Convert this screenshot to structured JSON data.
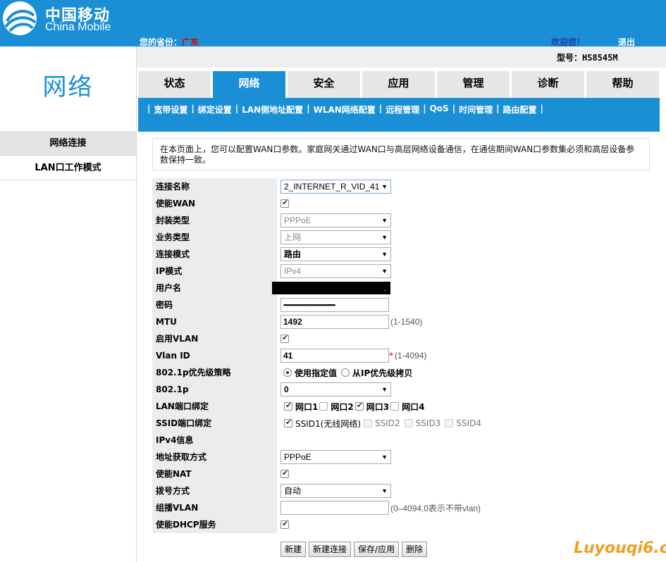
{
  "header": {
    "brand_cn": "中国移动",
    "brand_en": "China Mobile",
    "province_label": "您的省份：",
    "province_value": "广东",
    "welcome": "欢迎您！",
    "logout": "退出",
    "model": "型号：HS8545M"
  },
  "section_title": "网络",
  "left_nav": [
    {
      "label": "网络连接",
      "active": true
    },
    {
      "label": "LAN口工作模式",
      "active": false
    }
  ],
  "tabs": [
    "状态",
    "网络",
    "安全",
    "应用",
    "管理",
    "诊断",
    "帮助"
  ],
  "active_tab": "网络",
  "subnav": [
    "宽带设置",
    "绑定设置",
    "LAN侧地址配置",
    "WLAN网络配置",
    "远程管理",
    "QoS",
    "时间管理",
    "路由配置"
  ],
  "info_text": "在本页面上，您可以配置WAN口参数。家庭网关通过WAN口与高层网络设备通信，在通信期间WAN口参数集必须和高层设备参数保持一致。",
  "form": {
    "connection_name": {
      "label": "连接名称",
      "value": "2_INTERNET_R_VID_41"
    },
    "enable_wan": {
      "label": "使能WAN",
      "checked": true
    },
    "encap_type": {
      "label": "封装类型",
      "value": "PPPoE"
    },
    "service_type": {
      "label": "业务类型",
      "value": "上网"
    },
    "conn_mode": {
      "label": "连接模式",
      "value": "路由"
    },
    "ip_mode": {
      "label": "IP模式",
      "value": "IPv4"
    },
    "username": {
      "label": "用户名",
      "value": "."
    },
    "password": {
      "label": "密码",
      "value": "••••••••••••••••••••••••••••••••••"
    },
    "mtu": {
      "label": "MTU",
      "value": "1492",
      "hint": "(1-1540)"
    },
    "enable_vlan": {
      "label": "启用VLAN",
      "checked": true
    },
    "vlan_id": {
      "label": "Vlan ID",
      "value": "41",
      "required": "*",
      "hint": "(1-4094)"
    },
    "p8021_policy": {
      "label": "802.1p优先级策略",
      "opt1": "使用指定值",
      "opt2": "从IP优先级拷贝"
    },
    "p8021": {
      "label": "802.1p",
      "value": "0"
    },
    "lan_bind": {
      "label": "LAN端口绑定",
      "ports": [
        {
          "name": "网口1",
          "checked": true
        },
        {
          "name": "网口2",
          "checked": false
        },
        {
          "name": "网口3",
          "checked": true
        },
        {
          "name": "网口4",
          "checked": false
        }
      ]
    },
    "ssid_bind": {
      "label": "SSID端口绑定",
      "ssids": [
        {
          "name": "SSID1(无线网络)",
          "checked": true,
          "enabled": true
        },
        {
          "name": "SSID2",
          "checked": false,
          "enabled": false
        },
        {
          "name": "SSID3",
          "checked": false,
          "enabled": false
        },
        {
          "name": "SSID4",
          "checked": false,
          "enabled": false
        }
      ]
    },
    "ipv4_info": {
      "label": "IPv4信息"
    },
    "addr_method": {
      "label": "地址获取方式",
      "value": "PPPoE"
    },
    "enable_nat": {
      "label": "使能NAT",
      "checked": true
    },
    "dial_mode": {
      "label": "拨号方式",
      "value": "自动"
    },
    "multicast_vlan": {
      "label": "组播VLAN",
      "value": "",
      "hint": "(0–4094,0表示不带vlan)"
    },
    "enable_dhcp": {
      "label": "使能DHCP服务",
      "checked": true
    }
  },
  "buttons": [
    "新建",
    "新建连接",
    "保存/应用",
    "删除"
  ],
  "watermark": "Luyouqi6.cn"
}
